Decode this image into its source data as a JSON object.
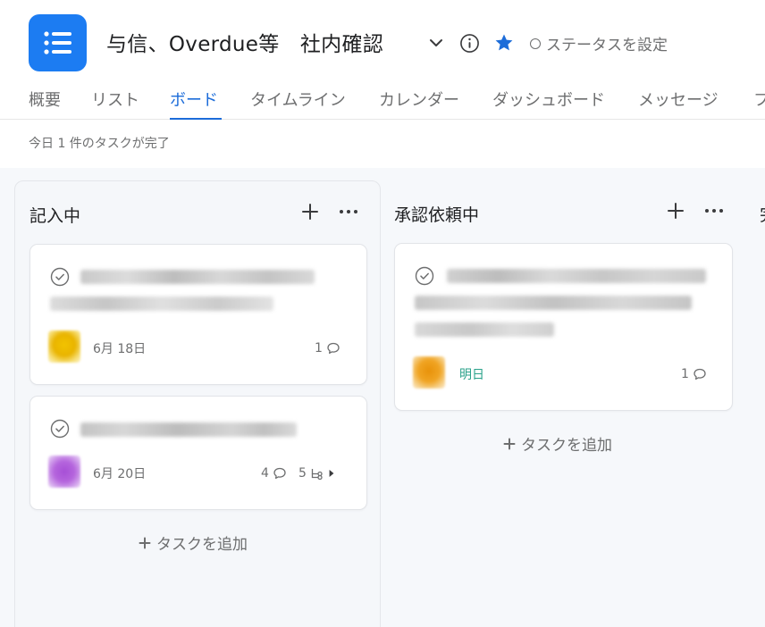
{
  "project": {
    "title": "与信、Overdue等　社内確認",
    "status_label": "ステータスを設定",
    "icon": "list-icon",
    "accent_color": "#1c7cf2"
  },
  "tabs": [
    {
      "label": "概要"
    },
    {
      "label": "リスト"
    },
    {
      "label": "ボード",
      "active": true
    },
    {
      "label": "タイムライン"
    },
    {
      "label": "カレンダー"
    },
    {
      "label": "ダッシュボード"
    },
    {
      "label": "メッセージ"
    },
    {
      "label": "フ"
    }
  ],
  "completed_summary": "今日 1 件のタスクが完了",
  "columns": [
    {
      "title": "記入中",
      "add_task_label": "タスクを追加",
      "cards": [
        {
          "due": "6月 18日",
          "comments": "1"
        },
        {
          "due": "6月 20日",
          "comments": "4",
          "subtasks": "5"
        }
      ]
    },
    {
      "title": "承認依頼中",
      "add_task_label": "タスクを追加",
      "cards": [
        {
          "due": "明日",
          "comments": "1",
          "due_color": "#2aa18a"
        }
      ]
    },
    {
      "title": "完"
    }
  ]
}
